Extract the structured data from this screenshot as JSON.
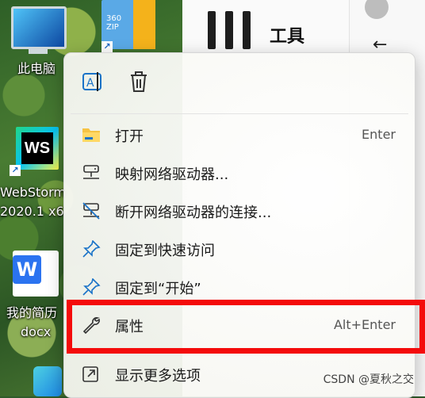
{
  "desktop": {
    "icons": [
      {
        "label": "此电脑"
      },
      {
        "label": "WebStorm",
        "sub": "2020.1 x6"
      },
      {
        "label": "我的简历",
        "sub": "docx"
      }
    ],
    "zip_text": "360\nZIP",
    "ws_text": "WS",
    "wps_text": "W"
  },
  "window": {
    "tools_title": "工具",
    "back_symbol": "←"
  },
  "menu": {
    "top_actions": [
      {
        "name": "rename",
        "icon": "rename-icon"
      },
      {
        "name": "delete",
        "icon": "trash-icon"
      }
    ],
    "items": [
      {
        "label": "打开",
        "shortcut": "Enter",
        "icon": "folder-icon"
      },
      {
        "label": "映射网络驱动器...",
        "shortcut": "",
        "icon": "network-drive-icon"
      },
      {
        "label": "断开网络驱动器的连接...",
        "shortcut": "",
        "icon": "disconnect-drive-icon"
      },
      {
        "label": "固定到快速访问",
        "shortcut": "",
        "icon": "pin-icon"
      },
      {
        "label": "固定到“开始”",
        "shortcut": "",
        "icon": "pin-icon"
      },
      {
        "label": "属性",
        "shortcut": "Alt+Enter",
        "icon": "wrench-icon"
      },
      {
        "label": "显示更多选项",
        "shortcut": "",
        "icon": "more-options-icon"
      }
    ]
  },
  "watermark": "CSDN @夏秋之交",
  "colors": {
    "highlight": "#f40b0b",
    "accent": "#1a73c8"
  }
}
